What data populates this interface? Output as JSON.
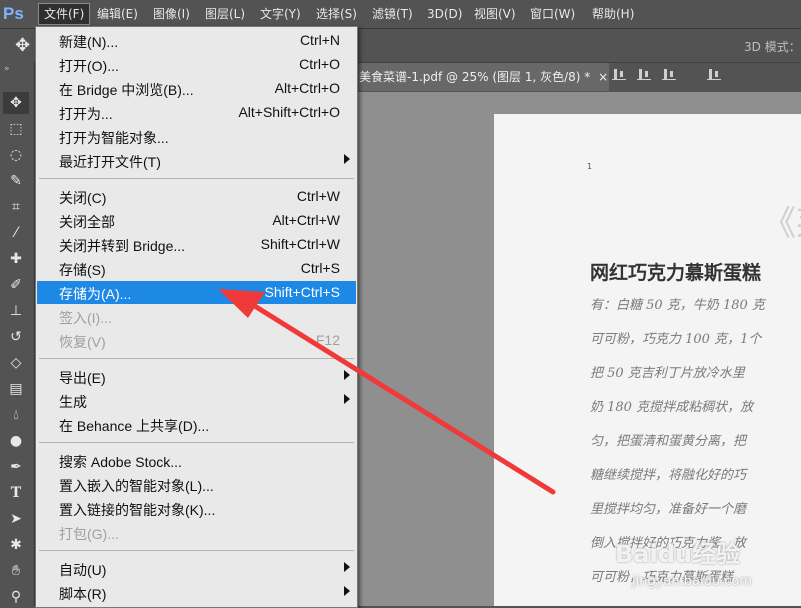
{
  "app": {
    "logo": "Ps"
  },
  "menubar": {
    "items": [
      "文件(F)",
      "编辑(E)",
      "图像(I)",
      "图层(L)",
      "文字(Y)",
      "选择(S)",
      "滤镜(T)",
      "3D(D)",
      "视图(V)",
      "窗口(W)",
      "帮助(H)"
    ]
  },
  "options": {
    "mode_label": "3D 模式："
  },
  "document": {
    "tab_title": "美食菜谱-1.pdf @ 25% (图层 1, 灰色/8) *",
    "close_glyph": "×",
    "page_number": "1",
    "heading_fragment": "《莱",
    "title": "网红巧克力慕斯蛋糕",
    "lines": [
      "有：白糖 50 克，牛奶 180 克",
      "可可粉，巧克力 100 克，1个",
      "把 50 克吉利丁片放冷水里",
      "奶 180 克搅拌成粘稠状，放",
      "匀，把蛋清和蛋黄分离，把",
      "糖继续搅拌，将融化好的巧",
      "里搅拌均匀，准备好一个磨",
      "倒入搅拌好的巧克力酱，放",
      "可可粉，巧克力慕斯蛋糕"
    ]
  },
  "file_menu": {
    "groups": [
      [
        {
          "label": "新建(N)...",
          "shortcut": "Ctrl+N"
        },
        {
          "label": "打开(O)...",
          "shortcut": "Ctrl+O"
        },
        {
          "label": "在 Bridge 中浏览(B)...",
          "shortcut": "Alt+Ctrl+O"
        },
        {
          "label": "打开为...",
          "shortcut": "Alt+Shift+Ctrl+O"
        },
        {
          "label": "打开为智能对象...",
          "shortcut": ""
        },
        {
          "label": "最近打开文件(T)",
          "shortcut": "",
          "submenu": true
        }
      ],
      [
        {
          "label": "关闭(C)",
          "shortcut": "Ctrl+W"
        },
        {
          "label": "关闭全部",
          "shortcut": "Alt+Ctrl+W"
        },
        {
          "label": "关闭并转到 Bridge...",
          "shortcut": "Shift+Ctrl+W"
        },
        {
          "label": "存储(S)",
          "shortcut": "Ctrl+S"
        },
        {
          "label": "存储为(A)...",
          "shortcut": "Shift+Ctrl+S",
          "highlighted": true
        },
        {
          "label": "签入(I)...",
          "shortcut": "",
          "disabled": true
        },
        {
          "label": "恢复(V)",
          "shortcut": "F12",
          "disabled": true
        }
      ],
      [
        {
          "label": "导出(E)",
          "shortcut": "",
          "submenu": true
        },
        {
          "label": "生成",
          "shortcut": "",
          "submenu": true
        },
        {
          "label": "在 Behance 上共享(D)...",
          "shortcut": ""
        }
      ],
      [
        {
          "label": "搜索 Adobe Stock...",
          "shortcut": ""
        },
        {
          "label": "置入嵌入的智能对象(L)...",
          "shortcut": ""
        },
        {
          "label": "置入链接的智能对象(K)...",
          "shortcut": ""
        },
        {
          "label": "打包(G)...",
          "shortcut": "",
          "disabled": true
        }
      ],
      [
        {
          "label": "自动(U)",
          "shortcut": "",
          "submenu": true
        },
        {
          "label": "脚本(R)",
          "shortcut": "",
          "submenu": true
        }
      ]
    ]
  },
  "watermark": {
    "brand": "Baidu经验",
    "url": "jingyan.baidu.com"
  },
  "annotation": {
    "arrow_color": "#f03a3a"
  },
  "colors": {
    "highlight": "#1e88e5",
    "menu_bg": "#e9e9e9",
    "chrome": "#535353"
  }
}
